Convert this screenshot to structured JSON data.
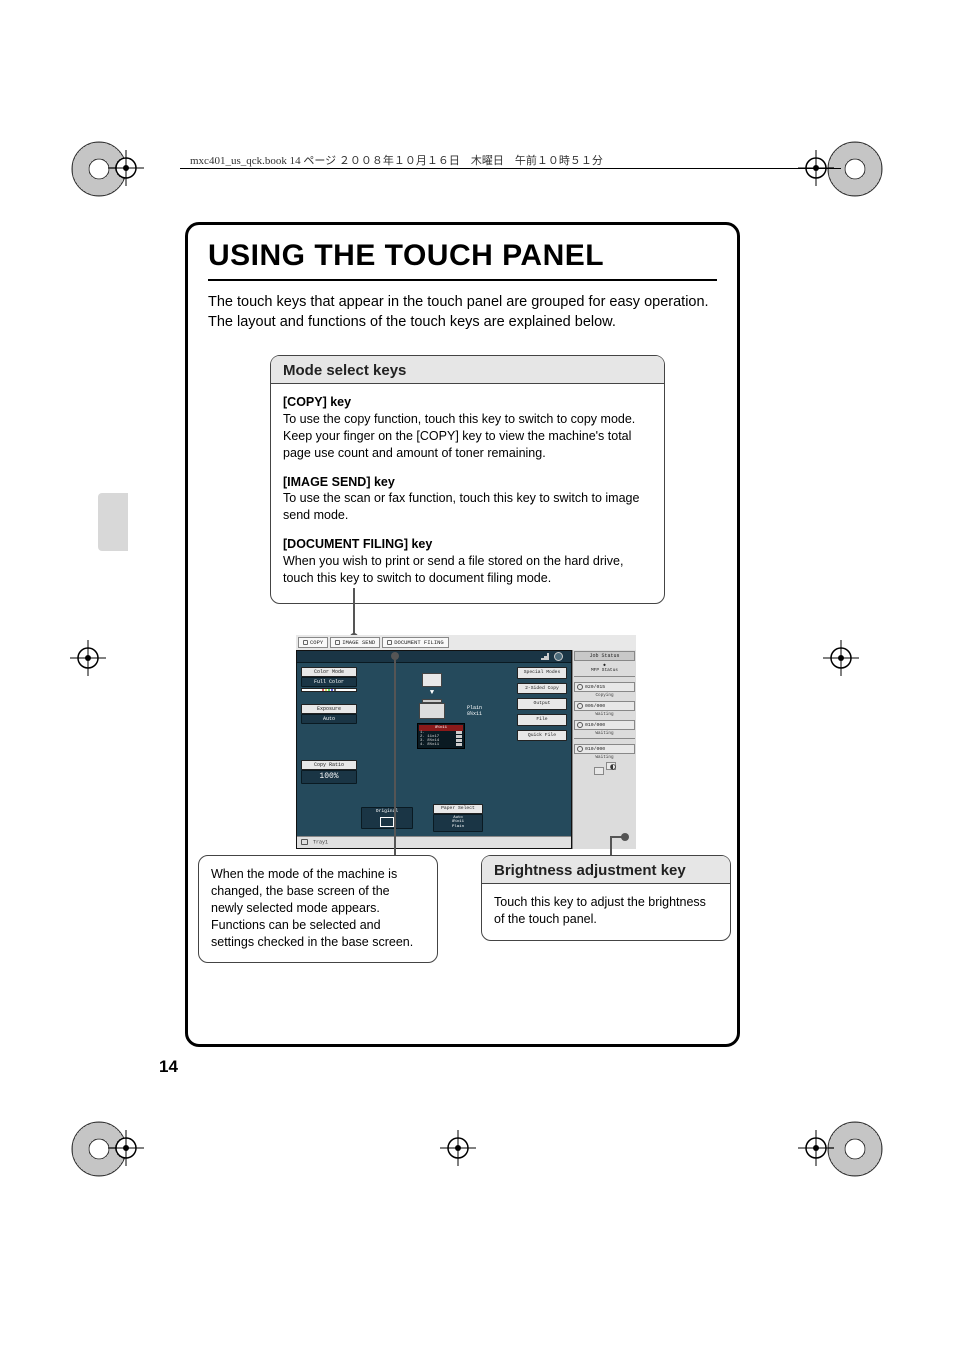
{
  "header_line": "mxc401_us_qck.book  14 ページ  ２００８年１０月１６日　木曜日　午前１０時５１分",
  "page_title": "USING THE TOUCH PANEL",
  "intro": "The touch keys that appear in the touch panel are grouped for easy operation. The layout and functions of the touch keys are explained below.",
  "mode_box": {
    "title": "Mode select keys",
    "items": [
      {
        "key": "[COPY] key",
        "desc": "To use the copy function, touch this key to switch to copy mode. Keep your finger on the [COPY] key to view the machine's total page use count and amount of toner remaining."
      },
      {
        "key": "[IMAGE SEND] key",
        "desc": "To use the scan or fax function, touch this key to switch to image send mode."
      },
      {
        "key": "[DOCUMENT FILING] key",
        "desc": "When you wish to print or send a file stored on the hard drive, touch this key to switch to document filing mode."
      }
    ]
  },
  "base_box": {
    "lines": [
      "When the mode of the machine is changed, the base screen of the newly selected mode appears.",
      "Functions can be selected and settings checked in the base screen."
    ]
  },
  "brightness_box": {
    "title": "Brightness adjustment key",
    "desc": "Touch this key to adjust the brightness of the touch panel."
  },
  "panel": {
    "tabs": {
      "copy": "COPY",
      "image_send": "IMAGE SEND",
      "doc_filing": "DOCUMENT FILING"
    },
    "left": {
      "color_mode": "Color Mode",
      "full_color": "Full Color",
      "exposure": "Exposure",
      "auto": "Auto",
      "copy_ratio": "Copy Ratio",
      "ratio_value": "100%"
    },
    "right": {
      "special": "Special Modes",
      "two_sided": "2-Sided Copy",
      "output": "Output",
      "file": "File",
      "quick_file": "Quick File"
    },
    "center": {
      "paper_plain": "Plain",
      "paper_size": "8½x11",
      "tray_hdr": "8½x11",
      "tray_rows": [
        "1.",
        "2. 11x17",
        "3. 8½x14",
        "4. 8½x11"
      ]
    },
    "bottom": {
      "original": "Original",
      "paper_select": "Paper Select",
      "ps_auto": "Auto",
      "ps_size": "8½x11",
      "ps_plain": "Plain",
      "tray_bar": "Tray1"
    },
    "status": {
      "hdr": "Job Status",
      "mfp": "MFP Status",
      "jobs": [
        {
          "count": "020/015",
          "state": "Copying"
        },
        {
          "count": "005/000",
          "state": "Waiting"
        },
        {
          "count": "010/000",
          "state": "Waiting"
        },
        {
          "count": "010/000",
          "state": "Waiting"
        }
      ]
    }
  },
  "page_number": "14"
}
